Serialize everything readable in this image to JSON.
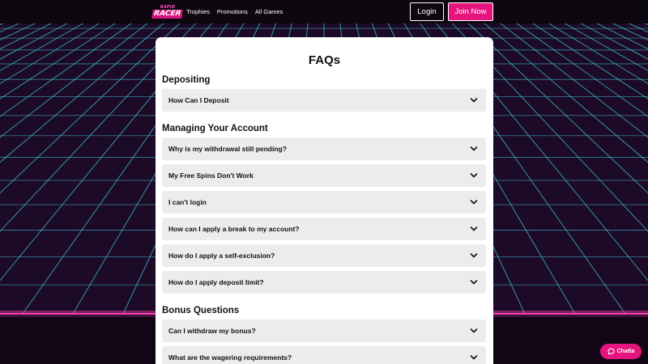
{
  "header": {
    "logo_top": "RAPID",
    "logo_main": "RACER",
    "nav": [
      "Trophies",
      "Promotions",
      "All Games"
    ],
    "login_label": "Login",
    "join_label": "Join Now"
  },
  "faq": {
    "title": "FAQs",
    "sections": [
      {
        "heading": "Depositing",
        "questions": [
          "How Can I Deposit"
        ]
      },
      {
        "heading": "Managing Your Account",
        "questions": [
          "Why is my withdrawal still pending?",
          "My Free Spins Don't Work",
          "I can't login",
          "How can I apply a break to my account?",
          "How do I apply a self-exclusion?",
          "How do I apply deposit limit?"
        ]
      },
      {
        "heading": "Bonus Questions",
        "questions": [
          "Can I withdraw my bonus?",
          "What are the wagering requirements?"
        ]
      }
    ]
  },
  "chat": {
    "label": "Chatta",
    "icon": "chat-bubble-icon"
  },
  "colors": {
    "accent": "#e5157d",
    "background": "#1c0b24",
    "grid_line": "#3fd6ea",
    "horizon_glow": "#ff3fb0",
    "faq_item_bg": "#ececec"
  }
}
